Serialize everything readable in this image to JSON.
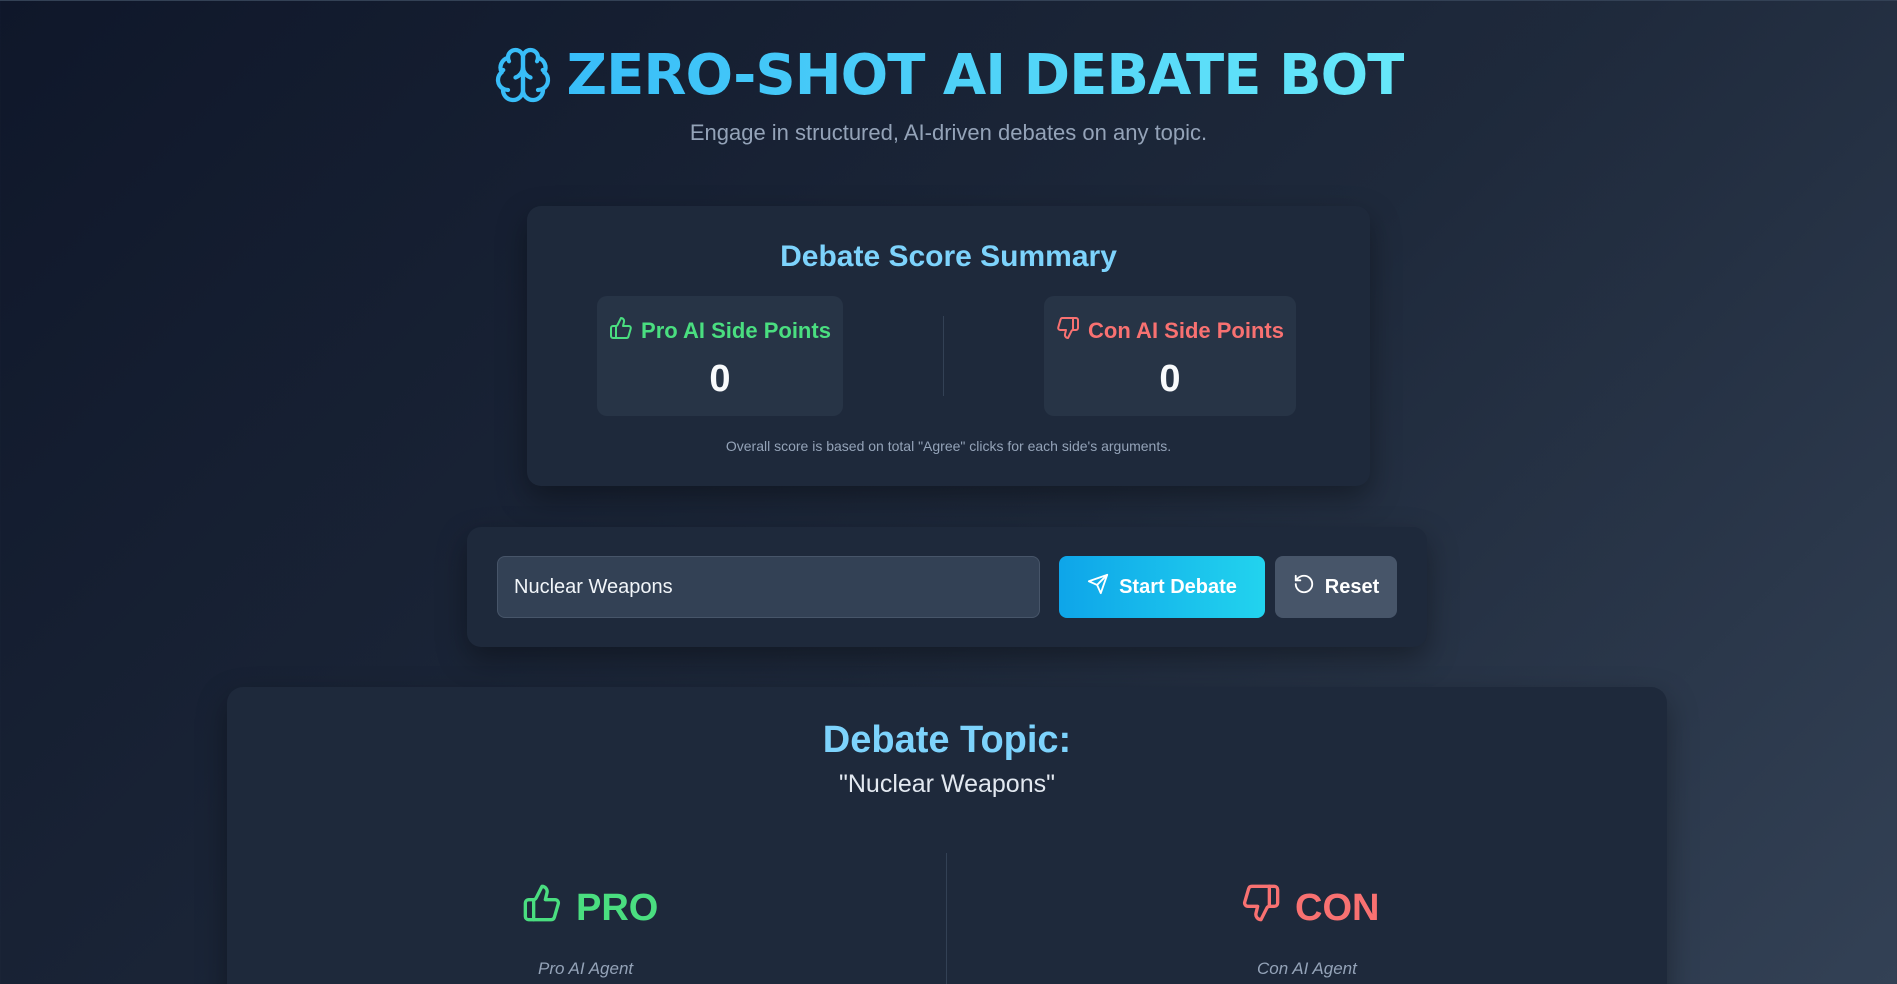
{
  "header": {
    "title": "ZERO-SHOT AI DEBATE BOT",
    "subtitle": "Engage in structured, AI-driven debates on any topic.",
    "icon": "brain-icon",
    "accent_color": "#38bdf8"
  },
  "scores": {
    "title": "Debate Score Summary",
    "pro": {
      "label": "Pro AI Side Points",
      "value": "0",
      "icon": "thumbs-up-icon",
      "color": "#4ade80"
    },
    "con": {
      "label": "Con AI Side Points",
      "value": "0",
      "icon": "thumbs-down-icon",
      "color": "#f87171"
    },
    "note": "Overall score is based on total \"Agree\" clicks for each side's arguments."
  },
  "controls": {
    "topic_value": "Nuclear Weapons",
    "start_label": "Start Debate",
    "start_icon": "send-icon",
    "reset_label": "Reset",
    "reset_icon": "rotate-ccw-icon"
  },
  "debate": {
    "heading": "Debate Topic:",
    "topic": "\"Nuclear Weapons\"",
    "pro": {
      "title": "PRO",
      "agent": "Pro AI Agent",
      "icon": "thumbs-up-icon"
    },
    "con": {
      "title": "CON",
      "agent": "Con AI Agent",
      "icon": "thumbs-down-icon"
    }
  }
}
